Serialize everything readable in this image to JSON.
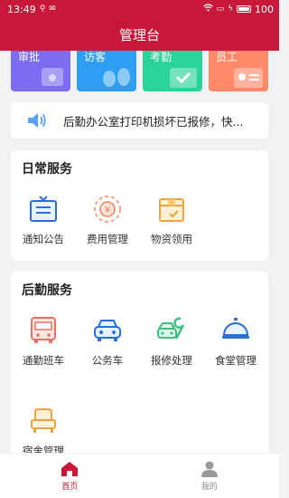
{
  "status_bar": {
    "time": "13:49",
    "battery": "100"
  },
  "header": {
    "title": "管理台"
  },
  "shortcuts": [
    {
      "label": "审批",
      "color": "#7b6cf0"
    },
    {
      "label": "访客",
      "color": "#2f9ef2"
    },
    {
      "label": "考勤",
      "color": "#29d39a"
    },
    {
      "label": "员工",
      "color": "#ff8a6b"
    }
  ],
  "notice": {
    "text": "后勤办公室打印机损坏已报修，快..."
  },
  "daily_services": {
    "title": "日常服务",
    "items": [
      {
        "label": "通知公告",
        "icon": "notice-icon"
      },
      {
        "label": "费用管理",
        "icon": "expense-icon"
      },
      {
        "label": "物资领用",
        "icon": "supplies-icon"
      }
    ]
  },
  "logistics_services": {
    "title": "后勤服务",
    "items": [
      {
        "label": "通勤班车",
        "icon": "bus-icon"
      },
      {
        "label": "公务车",
        "icon": "car-icon"
      },
      {
        "label": "报修处理",
        "icon": "repair-icon"
      },
      {
        "label": "食堂管理",
        "icon": "canteen-icon"
      },
      {
        "label": "宿舍管理",
        "icon": "dorm-icon"
      }
    ]
  },
  "tabbar": {
    "home": "首页",
    "mine": "我的",
    "active_color": "#c8183a"
  }
}
